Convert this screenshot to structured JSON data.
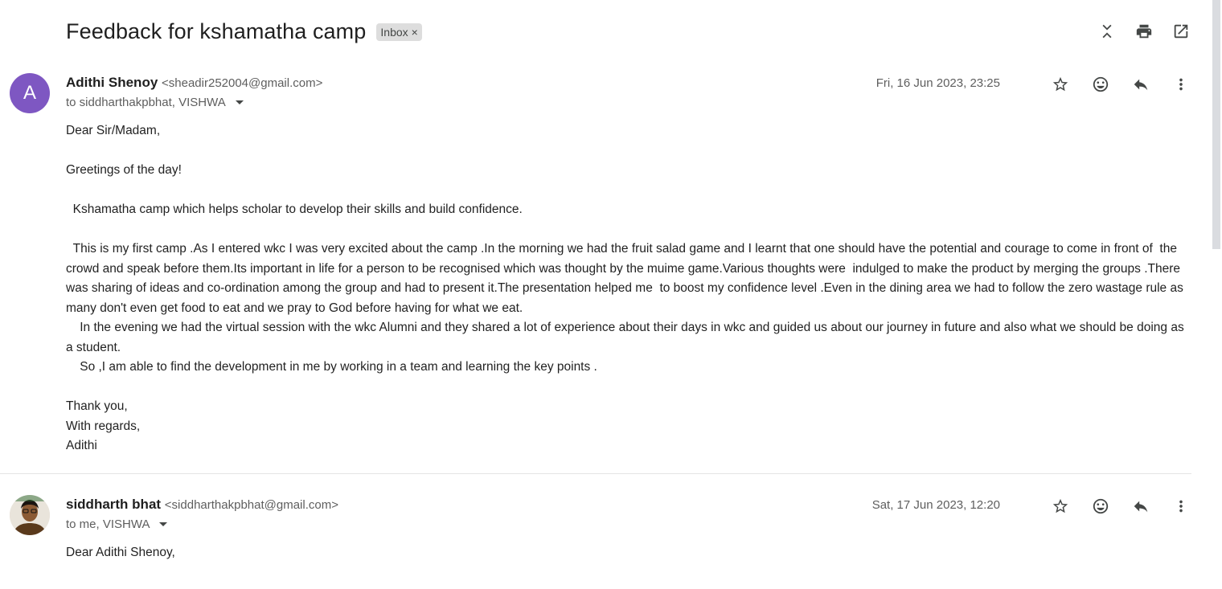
{
  "subject": "Feedback for kshamatha camp",
  "label": "Inbox",
  "label_close": "×",
  "top_icons": [
    "collapse-all-icon",
    "print-icon",
    "open-in-new-window-icon"
  ],
  "messages": [
    {
      "avatar_letter": "A",
      "sender_name": "Adithi Shenoy",
      "sender_email": "<sheadir252004@gmail.com>",
      "to": "to siddharthakpbhat, VISHWA",
      "date": "Fri, 16 Jun 2023, 23:25",
      "body": "Dear Sir/Madam,\n\nGreetings of the day!\n\n  Kshamatha camp which helps scholar to develop their skills and build confidence.\n\n  This is my first camp .As I entered wkc I was very excited about the camp .In the morning we had the fruit salad game and I learnt that one should have the potential and courage to come in front of  the crowd and speak before them.Its important in life for a person to be recognised which was thought by the muime game.Various thoughts were  indulged to make the product by merging the groups .There was sharing of ideas and co-ordination among the group and had to present it.The presentation helped me  to boost my confidence level .Even in the dining area we had to follow the zero wastage rule as many don't even get food to eat and we pray to God before having for what we eat.\n    In the evening we had the virtual session with the wkc Alumni and they shared a lot of experience about their days in wkc and guided us about our journey in future and also what we should be doing as a student.\n    So ,I am able to find the development in me by working in a team and learning the key points .\n\nThank you,\nWith regards,\nAdithi"
    },
    {
      "sender_name": "siddharth bhat",
      "sender_email": "<siddharthakpbhat@gmail.com>",
      "to": "to me, VISHWA",
      "date": "Sat, 17 Jun 2023, 12:20",
      "body": "Dear Adithi Shenoy,"
    }
  ],
  "message_icons": [
    "star-icon",
    "emoji-reaction-icon",
    "reply-icon",
    "more-options-icon"
  ]
}
